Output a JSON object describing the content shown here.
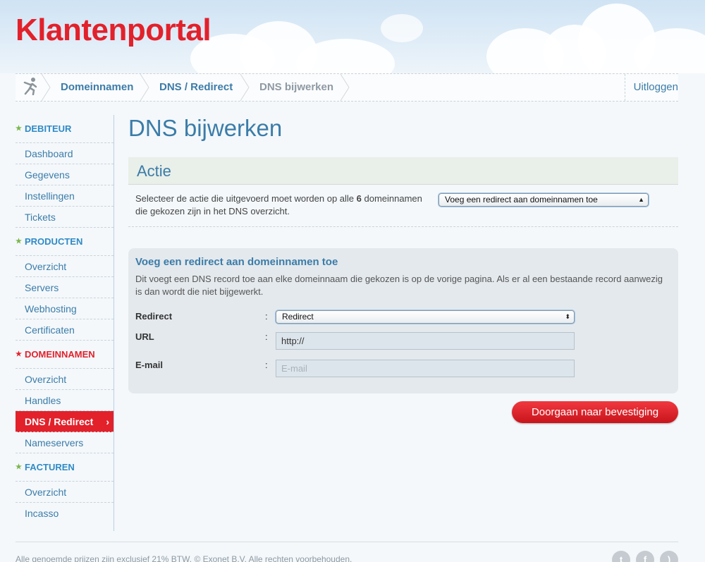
{
  "brand": {
    "logo": "Klantenportal",
    "accent": "#e2212b",
    "link": "#3b7ca8"
  },
  "breadcrumb": {
    "home_icon": "runner-icon",
    "items": [
      "Domeinnamen",
      "DNS / Redirect",
      "DNS bijwerken"
    ],
    "logout": "Uitloggen"
  },
  "sidebar": {
    "sections": [
      {
        "title": "DEBITEUR",
        "items": [
          "Dashboard",
          "Gegevens",
          "Instellingen",
          "Tickets"
        ]
      },
      {
        "title": "PRODUCTEN",
        "items": [
          "Overzicht",
          "Servers",
          "Webhosting",
          "Certificaten"
        ]
      },
      {
        "title": "DOMEINNAMEN",
        "items": [
          "Overzicht",
          "Handles",
          "DNS / Redirect",
          "Nameservers"
        ]
      },
      {
        "title": "FACTUREN",
        "items": [
          "Overzicht",
          "Incasso"
        ]
      }
    ],
    "active": "DNS / Redirect"
  },
  "main": {
    "title": "DNS bijwerken",
    "action": {
      "heading": "Actie",
      "text_pre": "Selecteer de actie die uitgevoerd moet worden op alle ",
      "count": "6",
      "text_post": " domeinnamen die gekozen zijn in het DNS overzicht.",
      "selected": "Voeg een redirect aan domeinnamen toe"
    },
    "form": {
      "title": "Voeg een redirect aan domeinnamen toe",
      "description": "Dit voegt een DNS record toe aan elke domeinnaam die gekozen is op de vorige pagina. Als er al een bestaande record aanwezig is dan wordt die niet bijgewerkt.",
      "redirect_label": "Redirect",
      "redirect_value": "Redirect",
      "url_label": "URL",
      "url_value": "http://",
      "email_label": "E-mail",
      "email_placeholder": "E-mail",
      "colon": ":"
    },
    "submit": "Doorgaan naar bevestiging"
  },
  "footer": {
    "text": "Alle genoemde prijzen zijn exclusief 21% BTW. © Exonet B.V. Alle rechten voorbehouden.",
    "social": [
      "twitter-icon",
      "facebook-icon",
      "rss-icon"
    ]
  }
}
